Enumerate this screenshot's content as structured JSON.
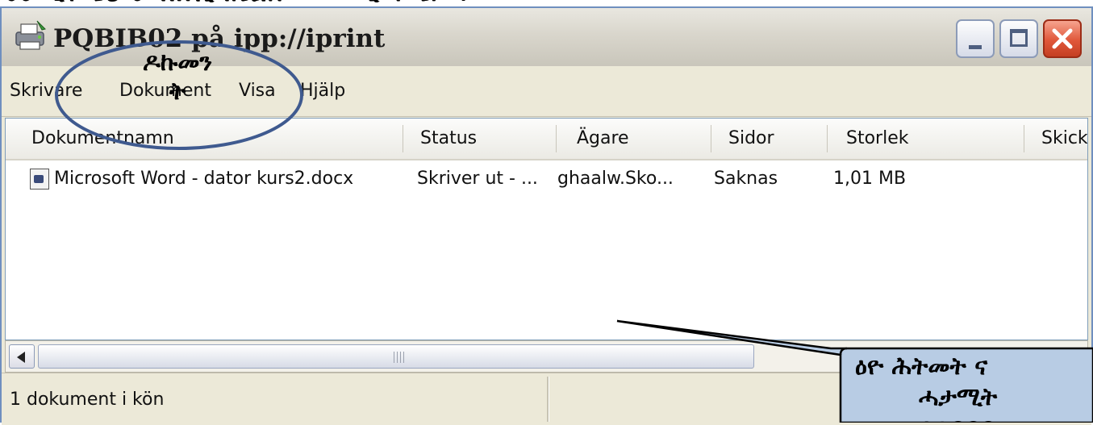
{
  "top_fragment": "ሀሁ ሂሃ ሄህ ሆ ለሉሊላሌልሎ መሙሚማሜምሞ",
  "window": {
    "title": "PQBIB02 på ipp://iprint",
    "minimize_label": "Minimize",
    "maximize_label": "Maximize",
    "close_label": "Close"
  },
  "menu": [
    "Skrivare",
    "Dokument",
    "Visa",
    "Hjälp"
  ],
  "columns": [
    "Dokumentnamn",
    "Status",
    "Ägare",
    "Sidor",
    "Storlek",
    "Skick"
  ],
  "rows": [
    {
      "name": "Microsoft Word - dator kurs2.docx",
      "status": "Skriver ut - ...",
      "owner": "ghaalw.Sko...",
      "pages": "Saknas",
      "size": "1,01 MB",
      "submitted": ""
    }
  ],
  "status_bar": "1 dokument i kön",
  "annotations": {
    "circle_label": "ዶኩመን\nት",
    "callout_lines": [
      "ዕዮ ሕትመት ና",
      "ሓታሚት",
      "ኣዕዳዳዳ"
    ],
    "circle_color": "#3f5a8f",
    "callout_fill": "#b8cce4"
  },
  "colors": {
    "title_bar": "#d9d6cc",
    "window_face": "#ece9d8",
    "close_button": "#e0573a",
    "list_border": "#7f9db9"
  }
}
